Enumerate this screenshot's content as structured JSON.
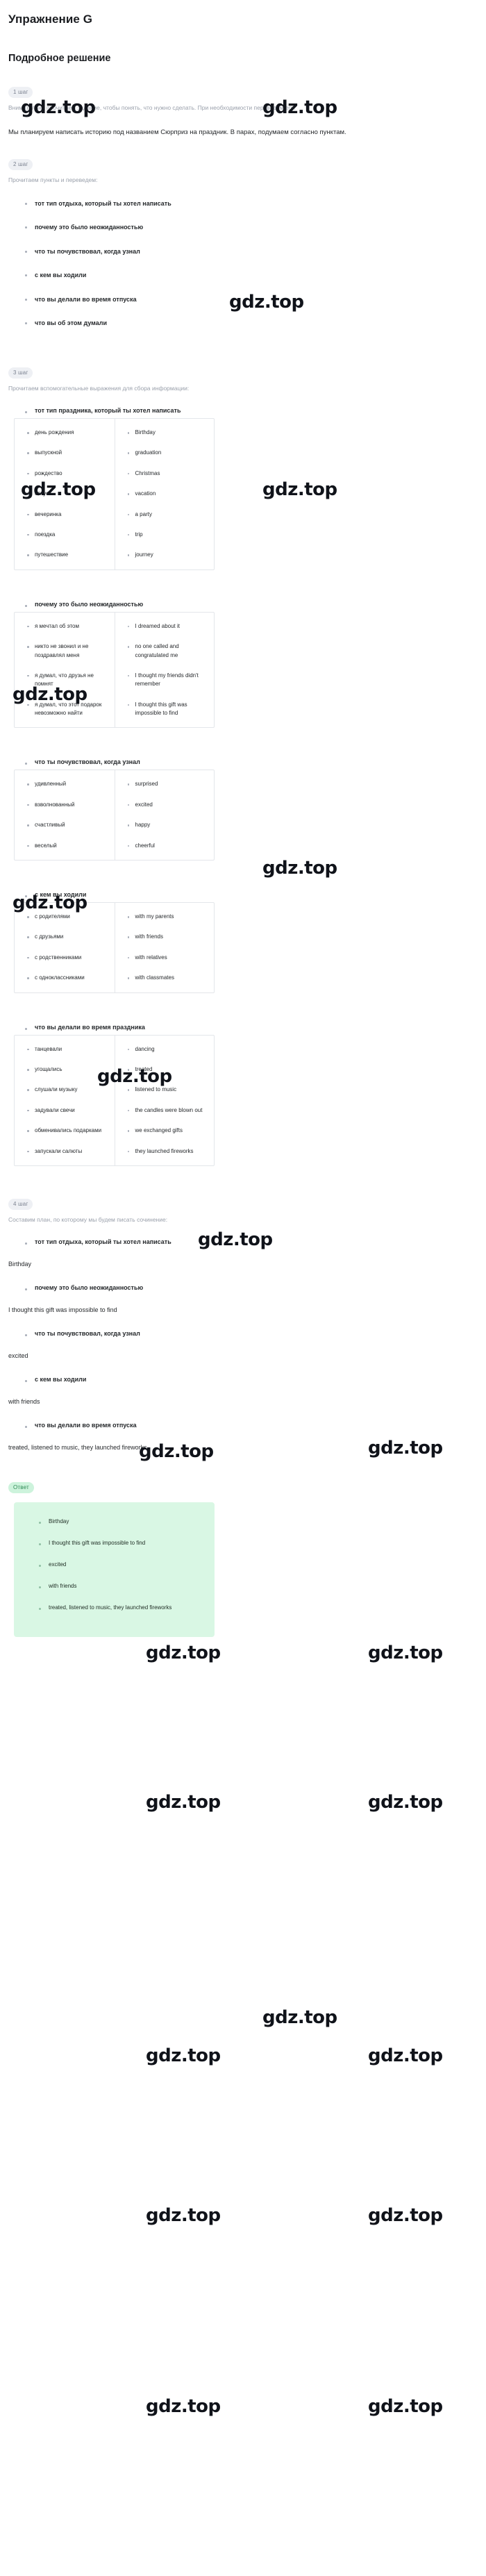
{
  "header": {
    "exercise_title": "Упражнение G",
    "solution_title": "Подробное решение"
  },
  "watermark": {
    "text": "gdz.top"
  },
  "steps": [
    {
      "badge": "1 шаг",
      "hint": "Внимательно прочитаем задание, чтобы понять, что нужно сделать. При необходимости переведем его.",
      "task": "Мы планируем написать историю под названием Сюрприз на праздник. В парах, подумаем согласно пунктам."
    },
    {
      "badge": "2 шаг",
      "hint": "Прочитаем пункты и переведем:",
      "points": [
        "тот тип отдыха, который ты хотел написать",
        "почему это было неожиданностью",
        "что ты почувствовал, когда узнал",
        "с кем вы ходили",
        "что вы делали во время отпуска",
        "что вы об этом думали"
      ]
    },
    {
      "badge": "3 шаг",
      "hint": "Прочитаем вспомогательные выражения для сбора информации:"
    },
    {
      "badge": "4 шаг",
      "hint": "Составим план, по которому мы будем писать сочинение:"
    }
  ],
  "groups": [
    {
      "heading": "тот тип праздника, который ты хотел написать",
      "ru": [
        "день рождения",
        "выпускной",
        "рождество",
        "отпуск",
        "вечеринка",
        "поездка",
        "путешествие"
      ],
      "en": [
        "Birthday",
        "graduation",
        "Christmas",
        "vacation",
        "a party",
        "trip",
        "journey"
      ]
    },
    {
      "heading": "почему это было неожиданностью",
      "ru": [
        "я мечтал об этом",
        "никто не звонил и не поздравлял меня",
        "я думал, что друзья не помнят",
        "я думал, что этот подарок невозможно найти"
      ],
      "en": [
        "I dreamed about it",
        "no one called and congratulated me",
        "I thought my friends didn't remember",
        "I thought this gift was impossible to find"
      ]
    },
    {
      "heading": "что ты почувствовал, когда узнал",
      "ru": [
        "удивленный",
        "взволнованный",
        "счастливый",
        "веселый"
      ],
      "en": [
        "surprised",
        "excited",
        "happy",
        "cheerful"
      ]
    },
    {
      "heading": "с кем вы ходили",
      "ru": [
        "с родителями",
        "с друзьями",
        "с родственниками",
        "с одноклассниками"
      ],
      "en": [
        "with my parents",
        "with friends",
        "with relatives",
        "with classmates"
      ]
    },
    {
      "heading": "что вы делали во время праздника",
      "ru": [
        "танцевали",
        "угощались",
        "слушали музыку",
        "задували свечи",
        "обменивались подарками",
        "запускали салюты"
      ],
      "en": [
        "dancing",
        "treated",
        "listened to music",
        "the candles were blown out",
        "we exchanged gifts",
        "they launched fireworks"
      ]
    }
  ],
  "plan": [
    {
      "point": "тот тип отдыха, который ты хотел написать",
      "answer": "Birthday"
    },
    {
      "point": "почему это было неожиданностью",
      "answer": "I thought this gift was impossible to find"
    },
    {
      "point": "что ты почувствовал, когда узнал",
      "answer": "excited"
    },
    {
      "point": "с кем вы ходили",
      "answer": "with friends"
    },
    {
      "point": "что вы делали во время отпуска",
      "answer": "treated, listened to music, they launched fireworks"
    }
  ],
  "answer": {
    "badge": "Ответ",
    "items": [
      "Birthday",
      "I thought this gift was impossible to find",
      "excited",
      "with friends",
      "treated, listened to music, they launched fireworks"
    ]
  }
}
